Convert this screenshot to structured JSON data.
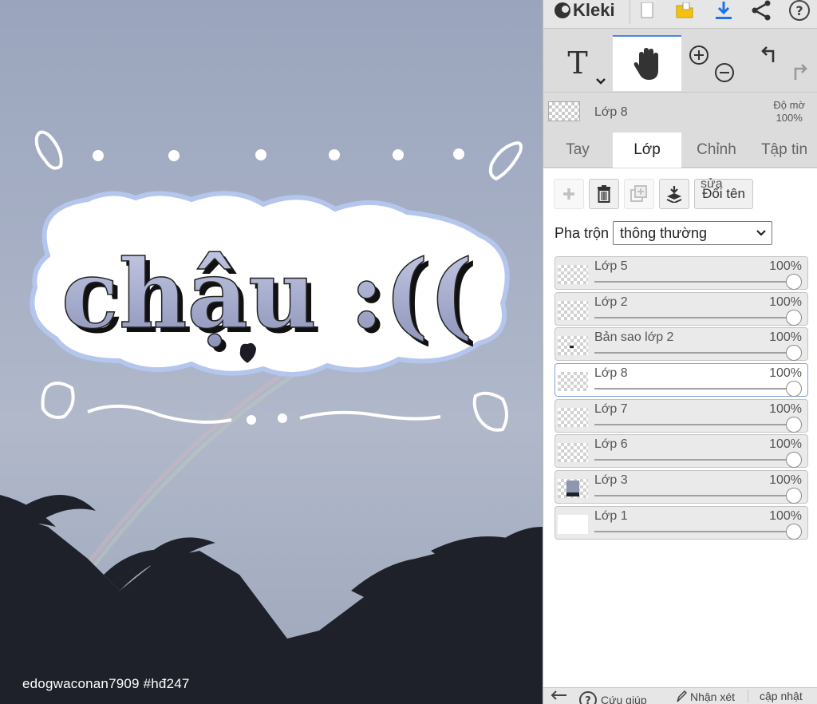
{
  "app": {
    "name": "Kleki"
  },
  "canvas": {
    "lettering": "chậu :((",
    "watermark": "edogwaconan7909  #hđ247"
  },
  "toolbar": {
    "icons": [
      "new-image-icon",
      "open-folder-icon",
      "download-icon",
      "share-icon",
      "help-icon"
    ]
  },
  "tools": {
    "text_glyph": "T",
    "active": "hand"
  },
  "current_layer": {
    "name": "Lớp 8",
    "opacity_label": "Độ mờ",
    "opacity_value": "100%"
  },
  "tabs": [
    {
      "label": "Tay"
    },
    {
      "label": "Lớp"
    },
    {
      "label": "Chỉnh"
    },
    {
      "label": "Tập tin"
    }
  ],
  "active_tab": "Lớp",
  "layer_actions": {
    "rename_overlay": "sửa",
    "rename_label": "Đổi tên"
  },
  "blend": {
    "label": "Pha trộn",
    "value": "thông thường"
  },
  "layers": [
    {
      "name": "Lớp 5",
      "opacity": "100%",
      "opacity_fraction": 1.0
    },
    {
      "name": "Lớp 2",
      "opacity": "100%",
      "opacity_fraction": 1.0
    },
    {
      "name": "Bản sao lớp 2",
      "opacity": "100%",
      "opacity_fraction": 1.0
    },
    {
      "name": "Lớp 8",
      "opacity": "100%",
      "opacity_fraction": 1.0,
      "selected": true
    },
    {
      "name": "Lớp 7",
      "opacity": "100%",
      "opacity_fraction": 1.0
    },
    {
      "name": "Lớp 6",
      "opacity": "100%",
      "opacity_fraction": 1.0
    },
    {
      "name": "Lớp 3",
      "opacity": "100%",
      "opacity_fraction": 1.0
    },
    {
      "name": "Lớp 1",
      "opacity": "100%",
      "opacity_fraction": 1.0
    }
  ],
  "footer": {
    "help_label": "Cứu giúp",
    "feedback_label": "Nhận xét",
    "update_label": "cập nhật"
  },
  "colors": {
    "accent_blue": "#1a73e8",
    "folder_yellow": "#f4c20d",
    "selection_border": "#7ea3db"
  }
}
